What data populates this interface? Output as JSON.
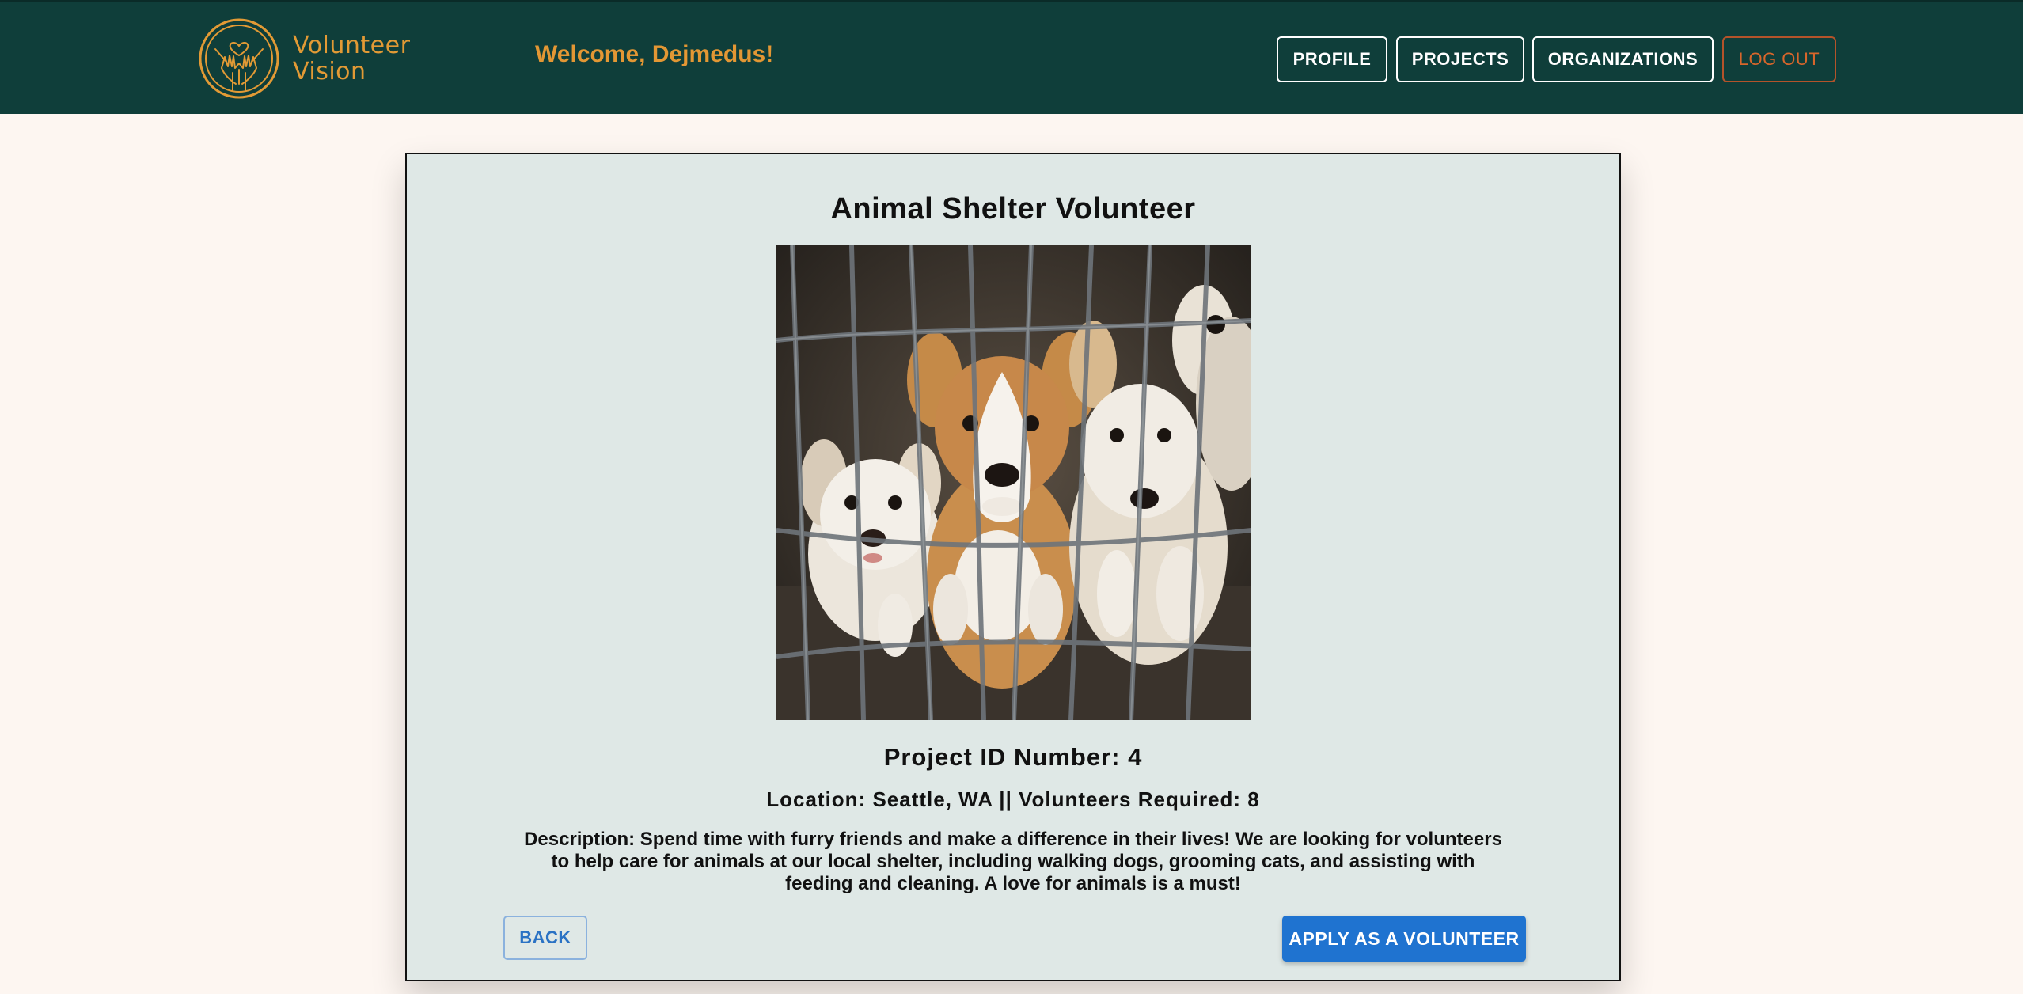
{
  "brand": {
    "name_line1": "Volunteer",
    "name_line2": "Vision",
    "accent_color": "#e39734",
    "header_color": "#0f3e3a"
  },
  "header": {
    "welcome": "Welcome, Dejmedus!",
    "nav": {
      "profile": "PROFILE",
      "projects": "PROJECTS",
      "organizations": "ORGANIZATIONS",
      "logout": "LOG OUT"
    }
  },
  "project": {
    "title": "Animal Shelter Volunteer",
    "image_icon": "puppies-in-cage-photo",
    "id_line": "Project ID Number: 4",
    "location_line": "Location: Seattle, WA || Volunteers Required: 8",
    "description": "Description: Spend time with furry friends and make a difference in their lives! We are looking for volunteers to help care for animals at our local shelter, including walking dogs, grooming cats, and assisting with feeding and cleaning. A love for animals is a must!"
  },
  "actions": {
    "back": "BACK",
    "apply": "APPLY AS A VOLUNTEER",
    "apply_color": "#1f73d0"
  }
}
